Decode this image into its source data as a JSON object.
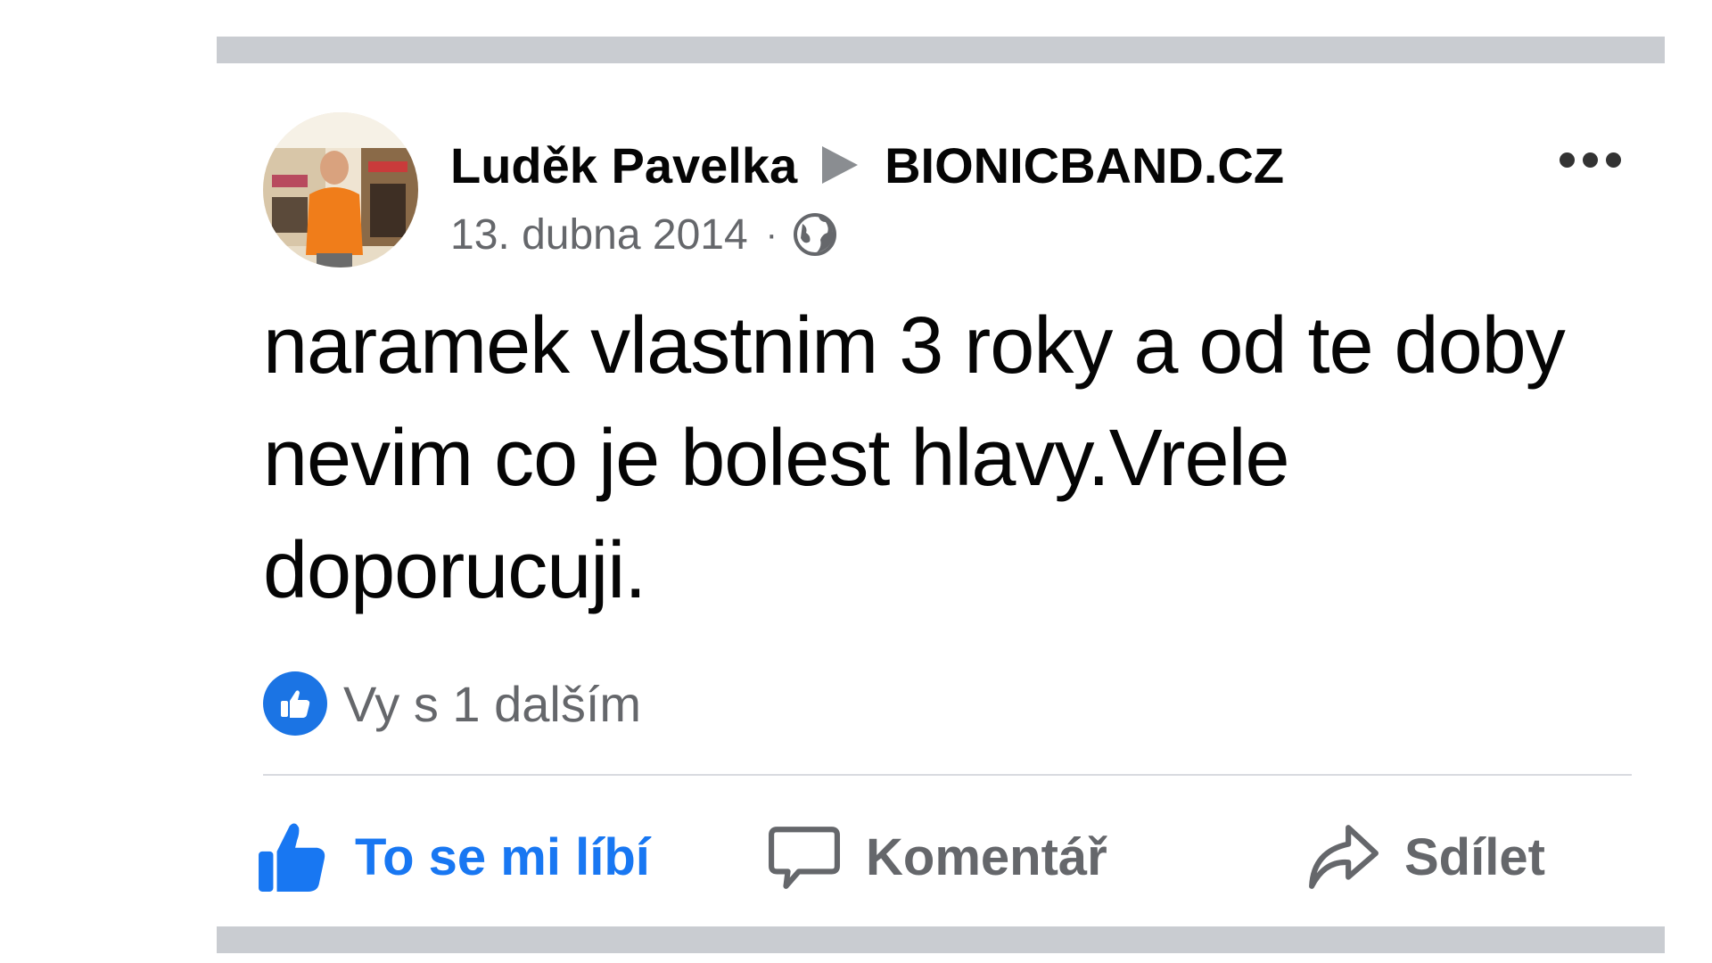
{
  "post": {
    "author": "Luděk Pavelka",
    "target_page": "BIONICBAND.CZ",
    "date": "13. dubna 2014",
    "separator": "·",
    "privacy_icon": "globe-icon",
    "more_icon": "more-options-icon",
    "text": "naramek vlastnim 3 roky a od te doby nevim co je bolest hlavy.Vrele doporucuji.",
    "reactions": {
      "icon": "like-reaction-icon",
      "summary": "Vy s 1 dalším"
    },
    "actions": {
      "like_label": "To se mi líbí",
      "comment_label": "Komentář",
      "share_label": "Sdílet"
    }
  },
  "colors": {
    "like_active": "#1877f2",
    "text_primary": "#050505",
    "text_secondary": "#65676b",
    "separator_bar": "#c9ccd1"
  }
}
